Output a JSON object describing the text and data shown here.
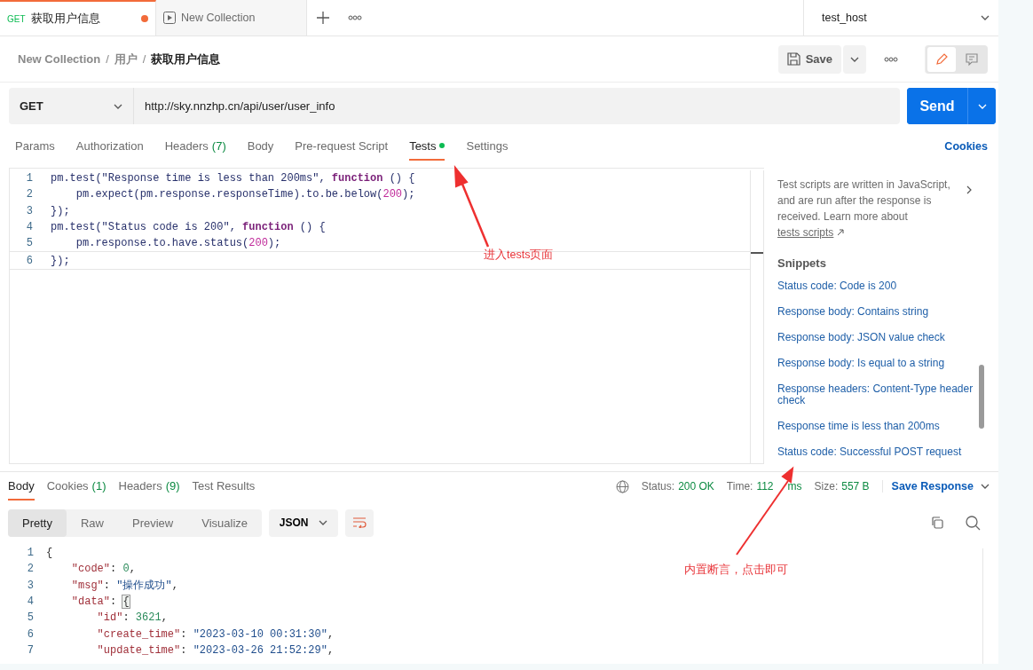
{
  "request_tabs": [
    {
      "kind": "request",
      "method": "GET",
      "title": "获取用户信息",
      "unsaved": true,
      "selected": true
    },
    {
      "kind": "collection",
      "title": "New Collection",
      "unsaved": false,
      "selected": false
    }
  ],
  "environment": {
    "value": "test_host"
  },
  "breadcrumb": {
    "separator": "/",
    "items": [
      "New Collection",
      "用户",
      "获取用户信息"
    ]
  },
  "save_button": {
    "label": "Save"
  },
  "view_modes": [
    {
      "kind": "edit",
      "selected": true
    },
    {
      "kind": "comments",
      "selected": false
    }
  ],
  "request": {
    "method": "GET",
    "url": "http://sky.nnzhp.cn/api/user/user_info",
    "send_label": "Send"
  },
  "tabs": [
    {
      "label": "Params",
      "selected": false
    },
    {
      "label": "Authorization",
      "selected": false
    },
    {
      "label": "Headers",
      "count": "(7)",
      "selected": false
    },
    {
      "label": "Body",
      "selected": false
    },
    {
      "label": "Pre-request Script",
      "selected": false
    },
    {
      "label": "Tests",
      "indicator": true,
      "selected": true
    },
    {
      "label": "Settings",
      "selected": false
    }
  ],
  "cookies_link": "Cookies",
  "editor": {
    "lines": [
      {
        "number": "1",
        "tokens": [
          {
            "kind": "plain",
            "text": "pm.test(\"Response time is less than 200ms\", "
          },
          {
            "kind": "keyword",
            "text": "function"
          },
          {
            "kind": "plain",
            "text": " () {"
          }
        ]
      },
      {
        "number": "2",
        "tokens": [
          {
            "kind": "plain",
            "text": "    pm.expect(pm.response.responseTime).to.be.below("
          },
          {
            "kind": "number",
            "text": "200"
          },
          {
            "kind": "plain",
            "text": ");"
          }
        ]
      },
      {
        "number": "3",
        "tokens": [
          {
            "kind": "plain",
            "text": "});"
          }
        ]
      },
      {
        "number": "4",
        "tokens": [
          {
            "kind": "plain",
            "text": "pm.test(\"Status code is 200\", "
          },
          {
            "kind": "keyword",
            "text": "function"
          },
          {
            "kind": "plain",
            "text": " () {"
          }
        ]
      },
      {
        "number": "5",
        "tokens": [
          {
            "kind": "plain",
            "text": "    pm.response.to.have.status("
          },
          {
            "kind": "number",
            "text": "200"
          },
          {
            "kind": "plain",
            "text": ");"
          }
        ]
      },
      {
        "number": "6",
        "tokens": [
          {
            "kind": "plain",
            "text": "});"
          }
        ]
      }
    ]
  },
  "side_panel": {
    "intro": "Test scripts are written in JavaScript, and are run after the response is received. Learn more about",
    "link": "tests scripts",
    "heading": "Snippets",
    "snippets": [
      "Status code: Code is 200",
      "Response body: Contains string",
      "Response body: JSON value check",
      "Response body: Is equal to a string",
      "Response headers: Content-Type header check",
      "Response time is less than 200ms",
      "Status code: Successful POST request"
    ]
  },
  "response": {
    "tabs": [
      {
        "label": "Body",
        "selected": true
      },
      {
        "label": "Cookies",
        "count": "(1)",
        "selected": false
      },
      {
        "label": "Headers",
        "count": "(9)",
        "selected": false
      },
      {
        "label": "Test Results",
        "selected": false
      }
    ],
    "status": {
      "status_label": "Status:",
      "status_value": "200 OK",
      "time_label": "Time:",
      "time_value": "112",
      "time_unit": "ms",
      "size_label": "Size:",
      "size_value": "557 B"
    },
    "save_response": "Save Response",
    "view_modes": [
      {
        "label": "Pretty",
        "selected": true
      },
      {
        "label": "Raw",
        "selected": false
      },
      {
        "label": "Preview",
        "selected": false
      },
      {
        "label": "Visualize",
        "selected": false
      }
    ],
    "format": "JSON",
    "lines": [
      {
        "number": "1",
        "tokens": [
          {
            "kind": "punct",
            "text": "{"
          }
        ]
      },
      {
        "number": "2",
        "tokens": [
          {
            "kind": "key",
            "text": "    \"code\""
          },
          {
            "kind": "punct",
            "text": ": "
          },
          {
            "kind": "number",
            "text": "0"
          },
          {
            "kind": "punct",
            "text": ","
          }
        ]
      },
      {
        "number": "3",
        "tokens": [
          {
            "kind": "key",
            "text": "    \"msg\""
          },
          {
            "kind": "punct",
            "text": ": "
          },
          {
            "kind": "string",
            "text": "\"操作成功\""
          },
          {
            "kind": "punct",
            "text": ","
          }
        ]
      },
      {
        "number": "4",
        "tokens": [
          {
            "kind": "key",
            "text": "    \"data\""
          },
          {
            "kind": "punct",
            "text": ": "
          },
          {
            "kind": "match",
            "text": "{"
          }
        ]
      },
      {
        "number": "5",
        "tokens": [
          {
            "kind": "key",
            "text": "        \"id\""
          },
          {
            "kind": "punct",
            "text": ": "
          },
          {
            "kind": "number",
            "text": "3621"
          },
          {
            "kind": "punct",
            "text": ","
          }
        ]
      },
      {
        "number": "6",
        "tokens": [
          {
            "kind": "key",
            "text": "        \"create_time\""
          },
          {
            "kind": "punct",
            "text": ": "
          },
          {
            "kind": "string",
            "text": "\"2023-03-10 00:31:30\""
          },
          {
            "kind": "punct",
            "text": ","
          }
        ]
      },
      {
        "number": "7",
        "tokens": [
          {
            "kind": "key",
            "text": "        \"update_time\""
          },
          {
            "kind": "punct",
            "text": ": "
          },
          {
            "kind": "string",
            "text": "\"2023-03-26 21:52:29\""
          },
          {
            "kind": "punct",
            "text": ","
          }
        ]
      }
    ]
  },
  "annotations": [
    {
      "text": "进入tests页面"
    },
    {
      "text": "内置断言，点击即可"
    }
  ]
}
